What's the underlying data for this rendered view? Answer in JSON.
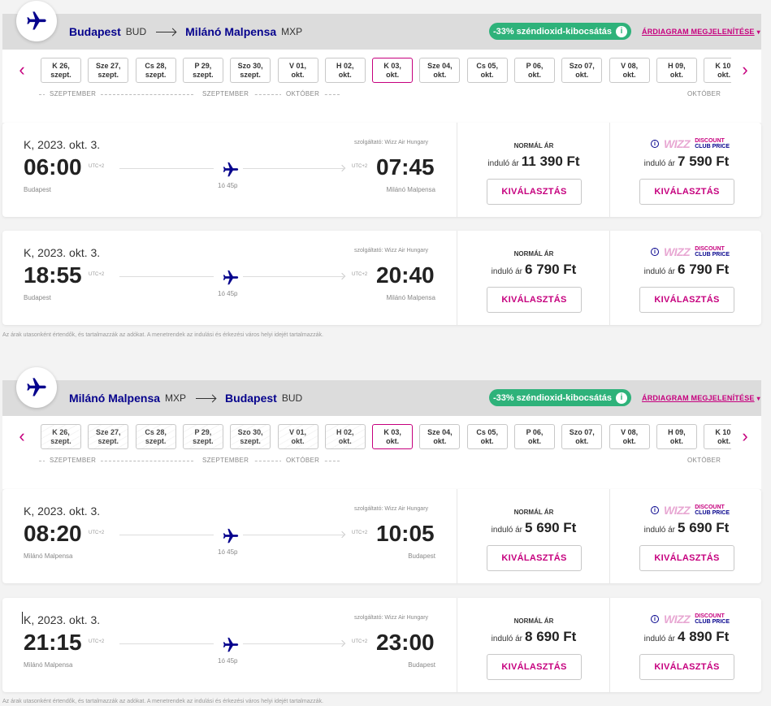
{
  "outbound": {
    "route": {
      "from_city": "Budapest",
      "from_code": "BUD",
      "to_city": "Milánó Malpensa",
      "to_code": "MXP"
    },
    "co2_label": "-33% széndioxid-kibocsátás",
    "chart_link": "ÁRDIAGRAM MEGJELENÍTÉSE",
    "dates": [
      {
        "l1": "K 26,",
        "l2": "szept."
      },
      {
        "l1": "Sze 27,",
        "l2": "szept."
      },
      {
        "l1": "Cs 28,",
        "l2": "szept."
      },
      {
        "l1": "P 29,",
        "l2": "szept."
      },
      {
        "l1": "Szo 30,",
        "l2": "szept."
      },
      {
        "l1": "V 01,",
        "l2": "okt."
      },
      {
        "l1": "H 02,",
        "l2": "okt."
      },
      {
        "l1": "K 03,",
        "l2": "okt."
      },
      {
        "l1": "Sze 04,",
        "l2": "okt."
      },
      {
        "l1": "Cs 05,",
        "l2": "okt."
      },
      {
        "l1": "P 06,",
        "l2": "okt."
      },
      {
        "l1": "Szo 07,",
        "l2": "okt."
      },
      {
        "l1": "V 08,",
        "l2": "okt."
      },
      {
        "l1": "H 09,",
        "l2": "okt."
      },
      {
        "l1": "K 10,",
        "l2": "okt."
      }
    ],
    "months": {
      "m1": "SZEPTEMBER",
      "m2": "SZEPTEMBER",
      "m3": "OKTÓBER",
      "m4": "OKTÓBER"
    },
    "flights": [
      {
        "date": "K, 2023. okt. 3.",
        "operator": "szolgáltató: Wizz Air Hungary",
        "dep_time": "06:00",
        "arr_time": "07:45",
        "utc_dep": "UTC+2",
        "utc_arr": "UTC+2",
        "duration": "1ó 45p",
        "dep_city": "Budapest",
        "arr_city": "Milánó Malpensa",
        "normal_title": "NORMÁL ÁR",
        "from_label": "induló ár",
        "normal_price": "11 390 Ft",
        "wdc_price": "7 590 Ft",
        "select": "KIVÁLASZTÁS"
      },
      {
        "date": "K, 2023. okt. 3.",
        "operator": "szolgáltató: Wizz Air Hungary",
        "dep_time": "18:55",
        "arr_time": "20:40",
        "utc_dep": "UTC+2",
        "utc_arr": "UTC+2",
        "duration": "1ó 45p",
        "dep_city": "Budapest",
        "arr_city": "Milánó Malpensa",
        "normal_title": "NORMÁL ÁR",
        "from_label": "induló ár",
        "normal_price": "6 790 Ft",
        "wdc_price": "6 790 Ft",
        "select": "KIVÁLASZTÁS"
      }
    ]
  },
  "inbound": {
    "route": {
      "from_city": "Milánó Malpensa",
      "from_code": "MXP",
      "to_city": "Budapest",
      "to_code": "BUD"
    },
    "co2_label": "-33% széndioxid-kibocsátás",
    "chart_link": "ÁRDIAGRAM MEGJELENÍTÉSE",
    "dates": [
      {
        "l1": "K 26,",
        "l2": "szept."
      },
      {
        "l1": "Sze 27,",
        "l2": "szept."
      },
      {
        "l1": "Cs 28,",
        "l2": "szept."
      },
      {
        "l1": "P 29,",
        "l2": "szept."
      },
      {
        "l1": "Szo 30,",
        "l2": "szept."
      },
      {
        "l1": "V 01,",
        "l2": "okt."
      },
      {
        "l1": "H 02,",
        "l2": "okt."
      },
      {
        "l1": "K 03,",
        "l2": "okt."
      },
      {
        "l1": "Sze 04,",
        "l2": "okt."
      },
      {
        "l1": "Cs 05,",
        "l2": "okt."
      },
      {
        "l1": "P 06,",
        "l2": "okt."
      },
      {
        "l1": "Szo 07,",
        "l2": "okt."
      },
      {
        "l1": "V 08,",
        "l2": "okt."
      },
      {
        "l1": "H 09,",
        "l2": "okt."
      },
      {
        "l1": "K 10,",
        "l2": "okt."
      }
    ],
    "months": {
      "m1": "SZEPTEMBER",
      "m2": "SZEPTEMBER",
      "m3": "OKTÓBER",
      "m4": "OKTÓBER"
    },
    "flights": [
      {
        "date": "K, 2023. okt. 3.",
        "operator": "szolgáltató: Wizz Air Hungary",
        "dep_time": "08:20",
        "arr_time": "10:05",
        "utc_dep": "UTC+2",
        "utc_arr": "UTC+2",
        "duration": "1ó 45p",
        "dep_city": "Milánó Malpensa",
        "arr_city": "Budapest",
        "normal_title": "NORMÁL ÁR",
        "from_label": "induló ár",
        "normal_price": "5 690 Ft",
        "wdc_price": "5 690 Ft",
        "select": "KIVÁLASZTÁS"
      },
      {
        "date": "K, 2023. okt. 3.",
        "operator": "szolgáltató: Wizz Air Hungary",
        "dep_time": "21:15",
        "arr_time": "23:00",
        "utc_dep": "UTC+2",
        "utc_arr": "UTC+2",
        "duration": "1ó 45p",
        "dep_city": "Milánó Malpensa",
        "arr_city": "Budapest",
        "normal_title": "NORMÁL ÁR",
        "from_label": "induló ár",
        "normal_price": "8 690 Ft",
        "wdc_price": "4 890 Ft",
        "select": "KIVÁLASZTÁS"
      }
    ]
  },
  "wdc_label": {
    "wizz": "WIZZ",
    "discount": "DISCOUNT",
    "club_price": "CLUB PRICE"
  },
  "footnote": "Az árak utasonként értendők, és tartalmazzák az adókat. A menetrendek az indulási és érkezési város helyi idejét tartalmazzák.",
  "colors": {
    "brand_magenta": "#c6007e",
    "brand_navy": "#06038d",
    "co2_green": "#2eb27a"
  },
  "icons": {
    "badge": "plane-icon",
    "nav_prev": "chevron-left-icon",
    "nav_next": "chevron-right-icon",
    "info": "info-icon"
  }
}
